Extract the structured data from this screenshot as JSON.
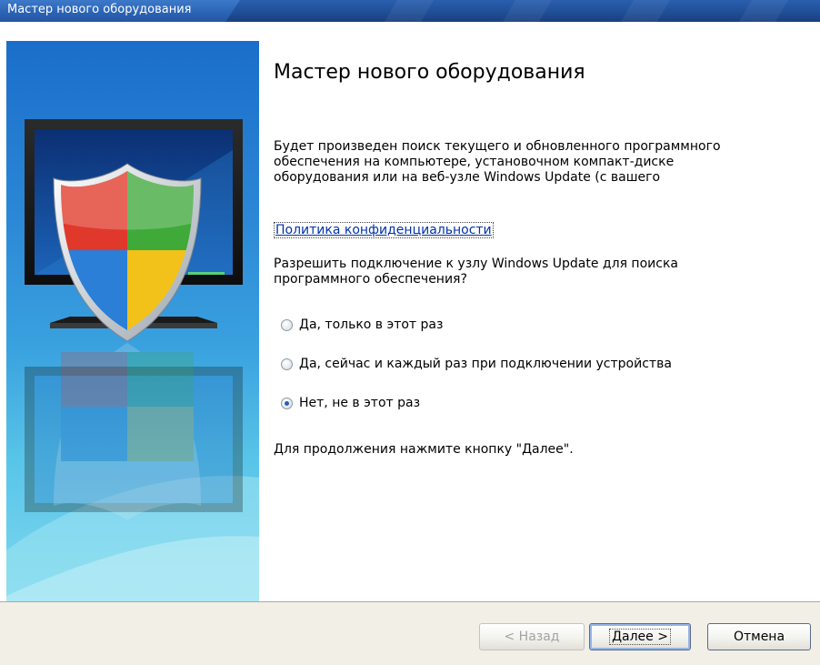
{
  "window": {
    "title": "Мастер нового оборудования"
  },
  "main": {
    "heading": "Мастер нового оборудования",
    "description_lines": [
      "Будет произведен поиск текущего и обновленного программного",
      "обеспечения на компьютере, установочном компакт-диске",
      "оборудования или на веб-узле Windows Update (с вашего"
    ],
    "privacy_link": "Политика конфиденциальности",
    "question_lines": [
      "Разрешить подключение к узлу Windows Update для поиска",
      "программного обеспечения?"
    ],
    "options": [
      {
        "label": "Да, только в этот раз",
        "checked": false
      },
      {
        "label": "Да, сейчас и каждый раз при подключении устройства",
        "checked": false
      },
      {
        "label": "Нет, не в этот раз",
        "checked": true
      }
    ],
    "continue_hint": "Для продолжения нажмите кнопку \"Далее\"."
  },
  "footer": {
    "back_label": "< Назад",
    "next_label": "Далее >",
    "cancel_label": "Отмена"
  },
  "colors": {
    "link": "#0033aa",
    "title_bar": "#2a5fae",
    "footer_bg": "#f1efe6",
    "banner_top": "#1a6ec9",
    "banner_bottom": "#7fd8ee"
  },
  "icons": [
    "shield-icon",
    "monitor-icon"
  ]
}
